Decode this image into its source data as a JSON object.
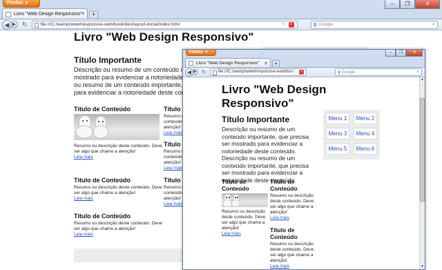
{
  "browser": {
    "app_button": "Firefox",
    "window_controls": [
      "–",
      "❐",
      "✕"
    ],
    "new_tab_label": "+"
  },
  "back_window": {
    "tab_title": "Livro \"Web Design Responsivo\"",
    "url": "file:///C:/wamp/www/responsive-web/book/des/layout-inicial/index.html",
    "search_engine": "Google",
    "search_placeholder": "Google",
    "page": {
      "title": "Livro \"Web Design Responsivo\"",
      "heading": "Título Importante",
      "description": "Descrição ou resumo de um conteúdo importante, que precisa ser mostrado para evidenciar a notoriedade deste conteúdo. Descrição ou resumo de um conteúdo importante, que precisa ser mostrado para evidenciar a notoriedade deste conteúdo.",
      "cards": [
        {
          "title": "Título de Conteúdo",
          "text": "Resumo ou descrição deste conteúdo. Deve ser algo que chame a atenção!",
          "link": "Leia mais",
          "image": true
        },
        {
          "title": "Título de Conteúdo",
          "text": "Resumo ou descrição deste conteúdo. Deve ser algo que chame a atenção!",
          "link": "Leia mais",
          "image": false
        },
        {
          "title": "Título de Conteúdo",
          "text": "Resumo ou descrição deste conteúdo. Deve ser algo que chame a atenção!",
          "link": "Leia mais",
          "image": false
        },
        {
          "title": "Título de Conteúdo",
          "text": "Resumo ou descrição deste conteúdo. Deve ser algo que chame a atenção!",
          "link": "Leia mais",
          "image": false
        },
        {
          "title": "Título de Conteúdo",
          "text": "Resumo ou descrição deste conteúdo. Deve ser algo que chame a atenção!",
          "link": "Leia mais",
          "image": false
        },
        {
          "title": "Título de Conteúdo",
          "text": "Resumo ou descrição deste conteúdo. Deve ser algo que chame a atenção!",
          "link": "Leia mais",
          "image": false
        },
        {
          "title": "Título de Conteúdo",
          "text": "Resumo ou descrição deste conteúdo. Deve ser algo que chame a atenção!",
          "link": "Leia mais",
          "image": false
        }
      ]
    }
  },
  "front_window": {
    "tab_title": "Livro \"Web Design Responsivo\"",
    "url": "file:///C:/wamp/www/responsive-web/boo",
    "search_engine": "Google",
    "search_placeholder": "Google",
    "page": {
      "title": "Livro \"Web Design Responsivo\"",
      "heading": "Título Importante",
      "description": "Descrição ou resumo de um conteúdo importante, que precisa ser mostrado para evidenciar a notoriedade deste conteúdo. Descrição ou resumo de um conteúdo importante, que precisa ser mostrado para evidenciar a notoriedade deste conteúdo.",
      "menu": [
        "Menu 1",
        "Menu 2",
        "Menu 3",
        "Menu 4",
        "Menu 5",
        "Menu 6"
      ],
      "cards": [
        {
          "title": "Título de Conteúdo",
          "text": "Resumo ou descrição deste conteúdo. Deve ser algo que chame a atenção!",
          "link": "Leia mais",
          "image": true
        },
        {
          "title": "Título de Conteúdo",
          "text": "Resumo ou descrição deste conteúdo. Deve ser algo que chame a atenção!",
          "link": "Leia mais",
          "image": false
        },
        {
          "title": "Título de Conteúdo",
          "text": "Resumo ou descrição deste conteúdo. Deve ser algo que chame a atenção!",
          "link": "Leia mais",
          "image": false
        }
      ]
    }
  },
  "icons": {
    "back": "back-arrow-icon",
    "forward": "forward-arrow-icon",
    "reload": "reload-icon",
    "bookmark": "bookmark-star-icon",
    "feed": "feed-icon",
    "search": "search-icon"
  },
  "colors": {
    "firefox_button": "#e26b14",
    "link": "#1d4fd0",
    "chrome": "#cfdcef",
    "panel": "#ececec"
  }
}
